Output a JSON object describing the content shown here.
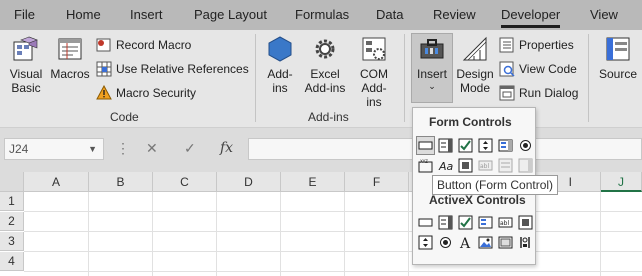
{
  "tabs": [
    {
      "label": "File"
    },
    {
      "label": "Home"
    },
    {
      "label": "Insert"
    },
    {
      "label": "Page Layout"
    },
    {
      "label": "Formulas"
    },
    {
      "label": "Data"
    },
    {
      "label": "Review"
    },
    {
      "label": "Developer"
    },
    {
      "label": "View"
    }
  ],
  "active_tab": "Developer",
  "ribbon": {
    "code": {
      "label": "Code",
      "visual_basic": "Visual Basic",
      "macros": "Macros",
      "record_macro": "Record Macro",
      "use_relative": "Use Relative References",
      "macro_security": "Macro Security"
    },
    "addins": {
      "label": "Add-ins",
      "addins": "Add-ins",
      "excel_addins": "Excel Add-ins",
      "com_addins": "COM Add-ins"
    },
    "controls": {
      "insert": "Insert",
      "design_mode": "Design Mode",
      "properties": "Properties",
      "view_code": "View Code",
      "run_dialog": "Run Dialog"
    },
    "xml": {
      "source": "Source"
    }
  },
  "formula_bar": {
    "name_box": "J24",
    "fx": "fx"
  },
  "grid": {
    "columns": [
      "A",
      "B",
      "C",
      "D",
      "E",
      "F",
      "I",
      "J"
    ],
    "rows": [
      "1",
      "2",
      "3",
      "4"
    ]
  },
  "dropdown": {
    "form_controls_label": "Form Controls",
    "activex_controls_label": "ActiveX Controls",
    "tooltip": "Button (Form Control)",
    "form_icons": [
      "button",
      "combo-box",
      "check-box",
      "spin-button",
      "list-box",
      "option-button",
      "group-box",
      "label",
      "scroll-bar",
      "text-field",
      "combo-list-edit",
      "combo-dropdown-edit"
    ],
    "activex_icons": [
      "command-button",
      "combo-box",
      "check-box",
      "list-box",
      "text-box",
      "spin-button",
      "option-button",
      "label",
      "image",
      "toggle-button",
      "more-controls"
    ]
  },
  "colors": {
    "tab_bar": "#b9b9b9",
    "ribbon": "#e6e6e6",
    "formula_bar": "#dcdcdc"
  }
}
